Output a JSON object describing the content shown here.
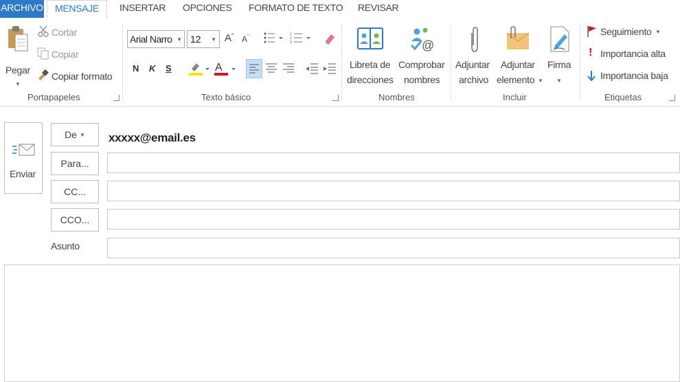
{
  "tabs": [
    {
      "label": "ARCHIVO"
    },
    {
      "label": "MENSAJE"
    },
    {
      "label": "INSERTAR"
    },
    {
      "label": "OPCIONES"
    },
    {
      "label": "FORMATO DE TEXTO"
    },
    {
      "label": "REVISAR"
    }
  ],
  "clipboard": {
    "paste_label": "Pegar",
    "cut_label": "Cortar",
    "copy_label": "Copiar",
    "format_painter_label": "Copiar formato",
    "group_label": "Portapapeles"
  },
  "basic_text": {
    "font_name": "Arial Narro",
    "font_size": "12",
    "bold": "N",
    "italic": "K",
    "underline": "S",
    "group_label": "Texto básico"
  },
  "names": {
    "address_book_line1": "Libreta de",
    "address_book_line2": "direcciones",
    "check_names_line1": "Comprobar",
    "check_names_line2": "nombres",
    "group_label": "Nombres"
  },
  "include": {
    "attach_file_line1": "Adjuntar",
    "attach_file_line2": "archivo",
    "attach_item_line1": "Adjuntar",
    "attach_item_line2": "elemento",
    "signature_label": "Firma",
    "group_label": "Incluir"
  },
  "tags": {
    "follow_up_label": "Seguimiento",
    "high_importance_label": "Importancia alta",
    "low_importance_label": "Importancia baja",
    "group_label": "Etiquetas"
  },
  "compose": {
    "send_label": "Enviar",
    "from_label": "De",
    "from_value": "xxxxx@email.es",
    "to_label": "Para...",
    "cc_label": "CC...",
    "bcc_label": "CCO...",
    "subject_label": "Asunto"
  },
  "colors": {
    "file_tab": "#2b79c7",
    "highlight": "#ffe400",
    "font_color": "#d9141b",
    "flag": "#d9141b",
    "low_importance": "#2b79c7"
  }
}
